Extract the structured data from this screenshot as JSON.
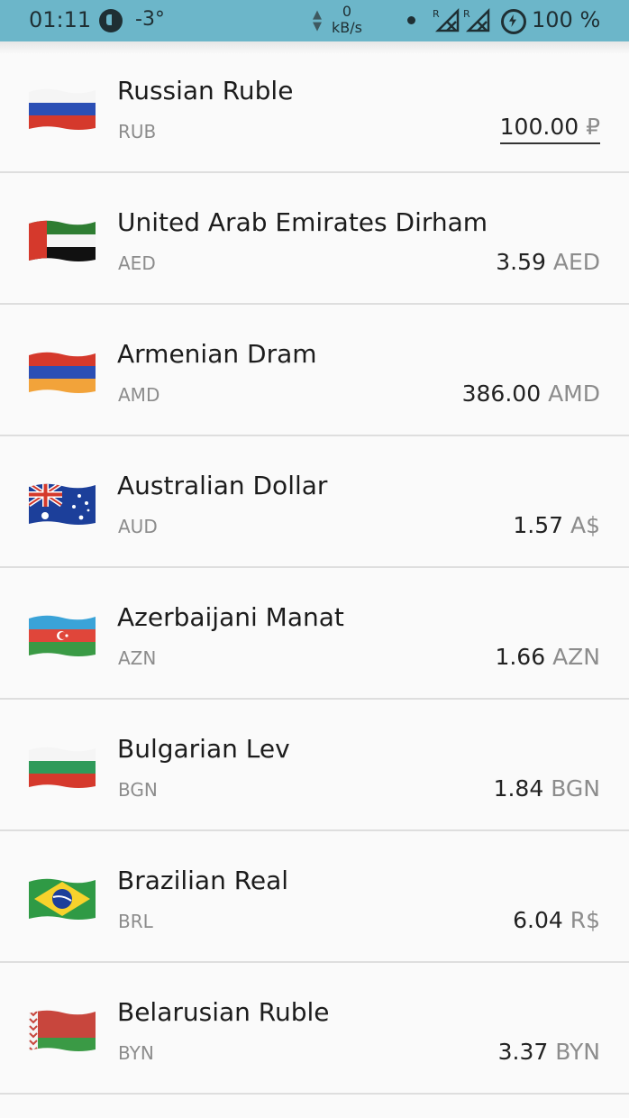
{
  "status_bar": {
    "time": "01:11",
    "temperature": "-3°",
    "speed_value": "0",
    "speed_unit": "kB/s",
    "signal_1_label": "R",
    "signal_2_label": "R",
    "battery": "100 %"
  },
  "currencies": [
    {
      "name": "Russian Ruble",
      "code": "RUB",
      "amount": "100.00",
      "symbol": "₽",
      "flag": "russia-flag"
    },
    {
      "name": "United Arab Emirates Dirham",
      "code": "AED",
      "amount": "3.59",
      "symbol": "AED",
      "flag": "uae-flag"
    },
    {
      "name": "Armenian Dram",
      "code": "AMD",
      "amount": "386.00",
      "symbol": "AMD",
      "flag": "armenia-flag"
    },
    {
      "name": "Australian Dollar",
      "code": "AUD",
      "amount": "1.57",
      "symbol": "A$",
      "flag": "australia-flag"
    },
    {
      "name": "Azerbaijani Manat",
      "code": "AZN",
      "amount": "1.66",
      "symbol": "AZN",
      "flag": "azerbaijan-flag"
    },
    {
      "name": "Bulgarian Lev",
      "code": "BGN",
      "amount": "1.84",
      "symbol": "BGN",
      "flag": "bulgaria-flag"
    },
    {
      "name": "Brazilian Real",
      "code": "BRL",
      "amount": "6.04",
      "symbol": "R$",
      "flag": "brazil-flag"
    },
    {
      "name": "Belarusian Ruble",
      "code": "BYN",
      "amount": "3.37",
      "symbol": "BYN",
      "flag": "belarus-flag"
    }
  ]
}
